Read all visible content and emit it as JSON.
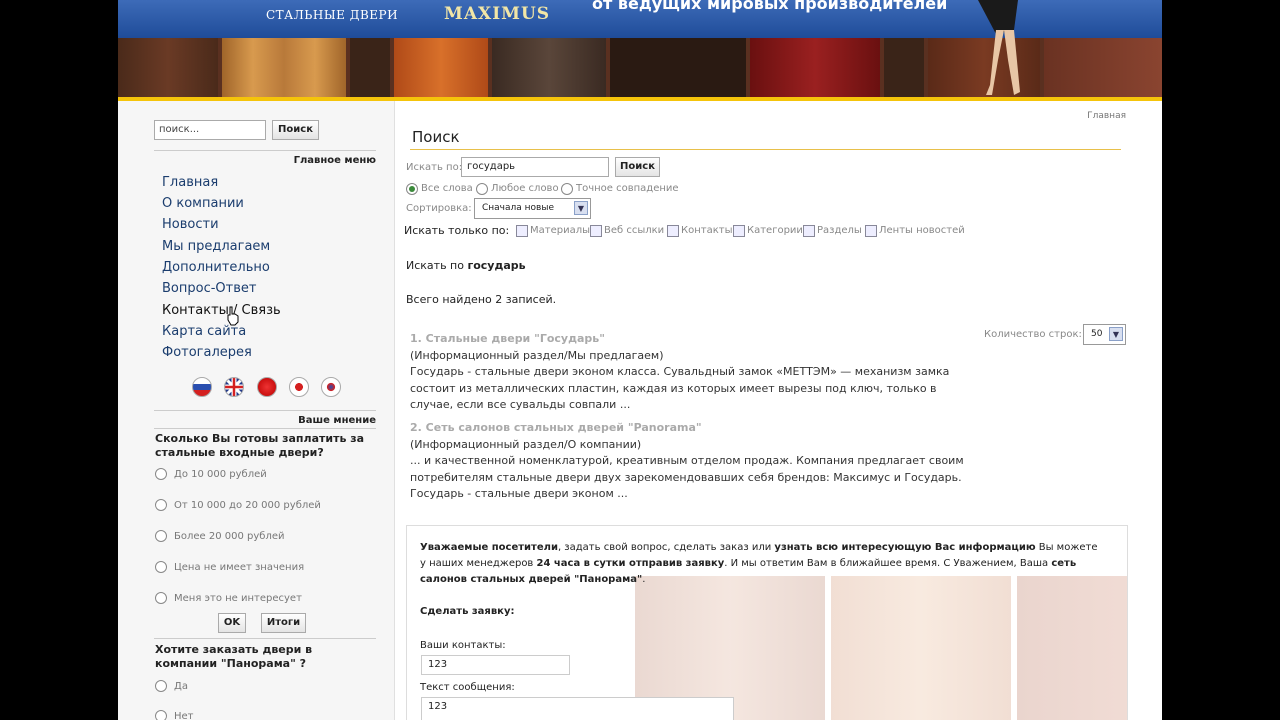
{
  "header": {
    "subtitle": "СТАЛЬНЫЕ ДВЕРИ",
    "logo": "MAXIMUS",
    "slogan": "от ведущих мировых производителей"
  },
  "sidebar": {
    "search_placeholder": "поиск...",
    "search_button": "Поиск",
    "menu_heading": "Главное меню",
    "menu_items": [
      "Главная",
      "О компании",
      "Новости",
      "Мы предлагаем",
      "Дополнительно",
      "Вопрос-Ответ",
      "Контакты / Связь",
      "Карта сайта",
      "Фотогалерея"
    ],
    "poll_heading": "Ваше мнение",
    "poll1_question": "Сколько Вы готовы заплатить за стальные входные двери?",
    "poll1_options": [
      "До 10 000 рублей",
      "От 10 000 до 20 000 рублей",
      "Более 20 000 рублей",
      "Цена не имеет значения",
      "Меня это не интересует"
    ],
    "ok_button": "OK",
    "results_button": "Итоги",
    "poll2_question": "Хотите заказать двери в компании \"Панорама\" ?",
    "poll2_options": [
      "Да",
      "Нет"
    ]
  },
  "main": {
    "breadcrumb": "Главная",
    "title": "Поиск",
    "search_label": "Искать по:",
    "search_value": "государь",
    "search_button": "Поиск",
    "match_options": [
      "Все слова",
      "Любое слово",
      "Точное совпадение"
    ],
    "sort_label": "Сортировка:",
    "sort_value": "Сначала новые",
    "only_label": "Искать только по:",
    "only_options": [
      "Материалы",
      "Веб ссылки",
      "Контакты",
      "Категории",
      "Разделы",
      "Ленты новостей"
    ],
    "search_for_prefix": "Искать по",
    "search_for_term": "государь",
    "total": "Всего найдено 2 записей.",
    "rows_label": "Количество строк:",
    "rows_value": "50",
    "results": [
      {
        "title": "1. Стальные двери \"Государь\"",
        "section": "(Информационный раздел/Мы предлагаем)",
        "snippet": "Государь - стальные двери эконом класса. Сувальдный замок «МЕТТЭМ» — механизм замка состоит из металлических пластин, каждая из которых имеет вырезы под ключ, только в случае, если все сувальды совпали ..."
      },
      {
        "title": "2. Сеть салонов стальных дверей \"Panorama\"",
        "section": "(Информационный раздел/О компании)",
        "snippet": "... и качественной номенклатурой, креативным отделом продаж. Компания предлагает своим потребителям стальные двери двух зарекомендовавших себя брендов: Максимус и Государь. Государь - стальные двери эконом ..."
      }
    ]
  },
  "form": {
    "t1": "Уважаемые посетители",
    "t2": ", задать свой вопрос, сделать заказ или ",
    "t3": "узнать всю интересующую Вас информацию",
    "t4": " Вы можете у наших менеджеров ",
    "t5": "24 часа в сутки отправив заявку",
    "t6": ". И мы ответим Вам в ближайшее время. С Уважением, Ваша ",
    "t7": "сеть салонов стальных дверей \"Панорама\"",
    "t8": ".",
    "make_request": "Сделать заявку:",
    "contacts_label": "Ваши контакты:",
    "contacts_value": "123",
    "message_label": "Текст сообщения:",
    "message_value": "123"
  }
}
